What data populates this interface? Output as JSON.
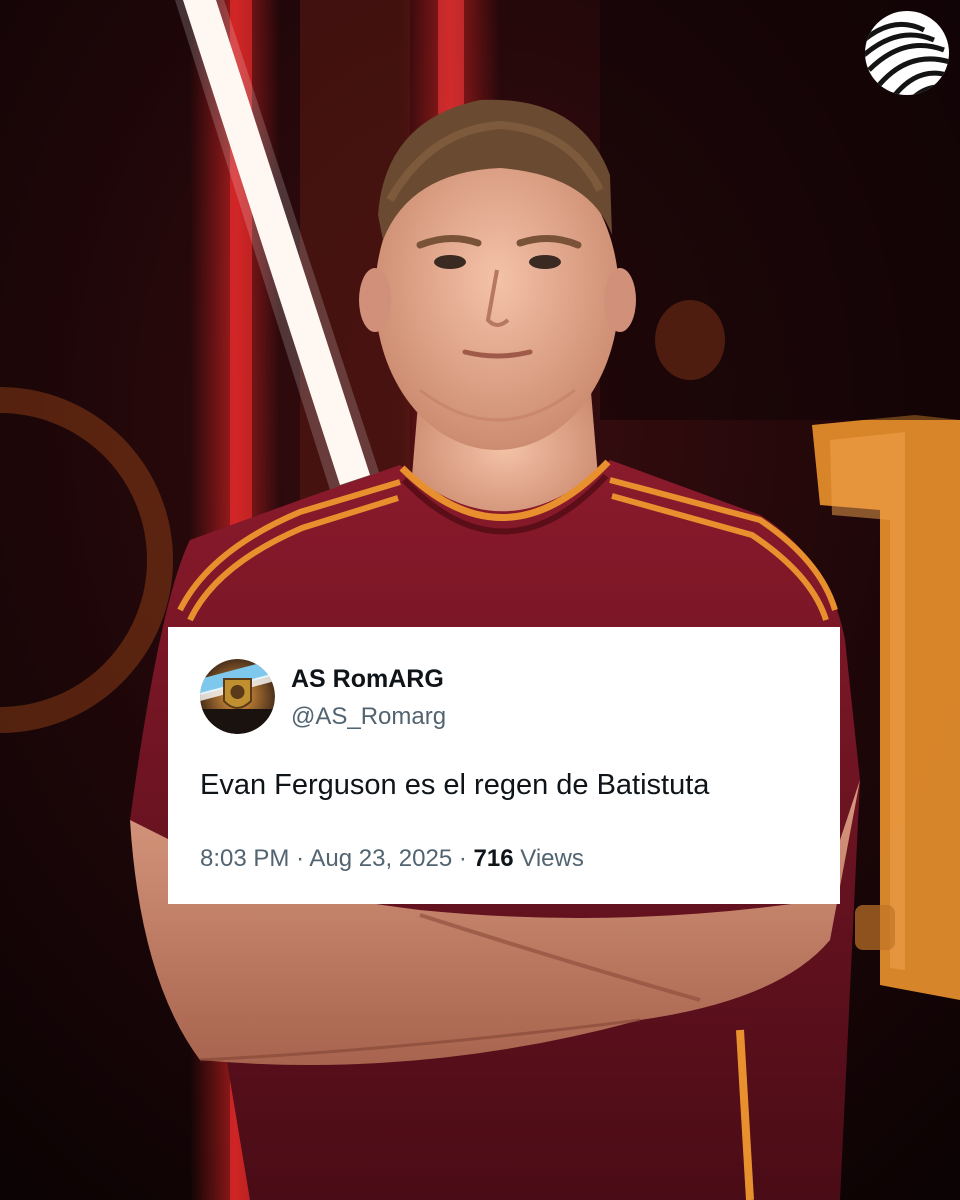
{
  "tweet": {
    "display_name": "AS RomARG",
    "handle": "@AS_Romarg",
    "text": "Evan Ferguson es el regen de Batistuta",
    "time": "8:03 PM",
    "separator": "·",
    "date": "Aug 23, 2025",
    "views_count": "716",
    "views_label": "Views"
  },
  "icons": {
    "logo": "striped-circle-logo-icon",
    "avatar": "as-roma-crest-avatar"
  },
  "colors": {
    "jersey": "#7a1626",
    "jersey_trim": "#e8902e",
    "neon_red": "#ff2a2a",
    "card_bg": "#ffffff",
    "name_text": "#0f1419",
    "secondary_text": "#536471"
  }
}
